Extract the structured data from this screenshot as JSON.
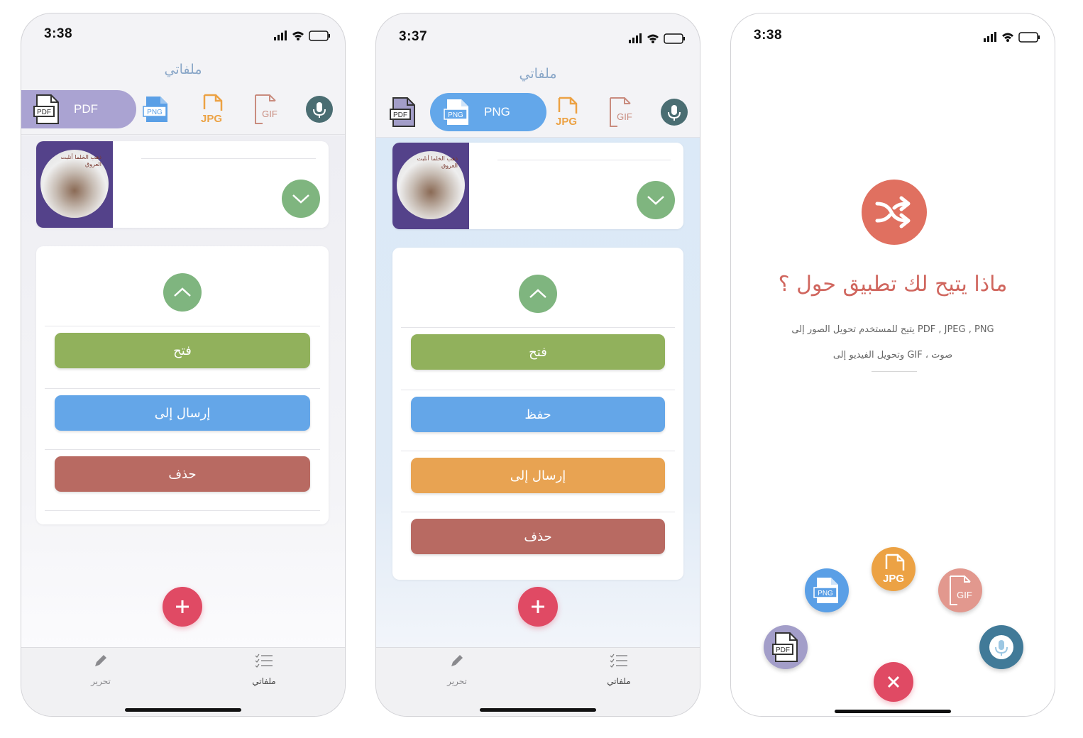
{
  "screens": [
    {
      "time": "3:38",
      "title": "ملفاتي",
      "tabs": [
        {
          "label": "PDF",
          "icon": "pdf-file-icon",
          "active": true,
          "color": "#a9a3d2"
        },
        {
          "label": "PNG",
          "icon": "png-file-icon",
          "active": false
        },
        {
          "label": "JPG",
          "icon": "jpg-file-icon",
          "active": false
        },
        {
          "label": "GIF",
          "icon": "gif-file-icon",
          "active": false
        },
        {
          "label": "",
          "icon": "microphone-icon",
          "active": false
        }
      ],
      "actions": [
        {
          "label": "فتح",
          "color": "#91b15c"
        },
        {
          "label": "إرسال إلى",
          "color": "#64a6e8"
        },
        {
          "label": "حذف",
          "color": "#b86a62"
        }
      ],
      "bottom_tabs": [
        {
          "label": "تحرير",
          "icon": "pencil-icon"
        },
        {
          "label": "ملفاتي",
          "icon": "list-icon"
        }
      ]
    },
    {
      "time": "3:37",
      "title": "ملفاتي",
      "tabs": [
        {
          "label": "PDF",
          "icon": "pdf-file-icon",
          "active": false
        },
        {
          "label": "PNG",
          "icon": "png-file-icon",
          "active": true,
          "color": "#63a7ea"
        },
        {
          "label": "JPG",
          "icon": "jpg-file-icon",
          "active": false
        },
        {
          "label": "GIF",
          "icon": "gif-file-icon",
          "active": false
        },
        {
          "label": "",
          "icon": "microphone-icon",
          "active": false
        }
      ],
      "actions": [
        {
          "label": "فتح",
          "color": "#91b15c"
        },
        {
          "label": "حفظ",
          "color": "#64a6e8"
        },
        {
          "label": "إرسال إلى",
          "color": "#e8a352"
        },
        {
          "label": "حذف",
          "color": "#b86a62"
        }
      ],
      "bottom_tabs": [
        {
          "label": "تحرير",
          "icon": "pencil-icon"
        },
        {
          "label": "ملفاتي",
          "icon": "list-icon"
        }
      ]
    },
    {
      "time": "3:38",
      "heading": "ماذا يتيح لك تطبيق حول ؟",
      "desc_line1": "يتيح للمستخدم تحويل الصور إلى PDF , JPEG , PNG",
      "desc_line2": "وتحويل الفيديو إلى GIF ، صوت",
      "bubbles": [
        "PDF",
        "PNG",
        "JPG",
        "GIF",
        "microphone"
      ],
      "colors": {
        "png": "#5a9fe6",
        "jpg": "#eca244",
        "gif": "#e2988e",
        "pdf": "#a39ec9",
        "mic": "#417a98",
        "close": "#e04a64"
      }
    }
  ],
  "thumbnail_text": "ذهب الخلما أنلبت العروق"
}
